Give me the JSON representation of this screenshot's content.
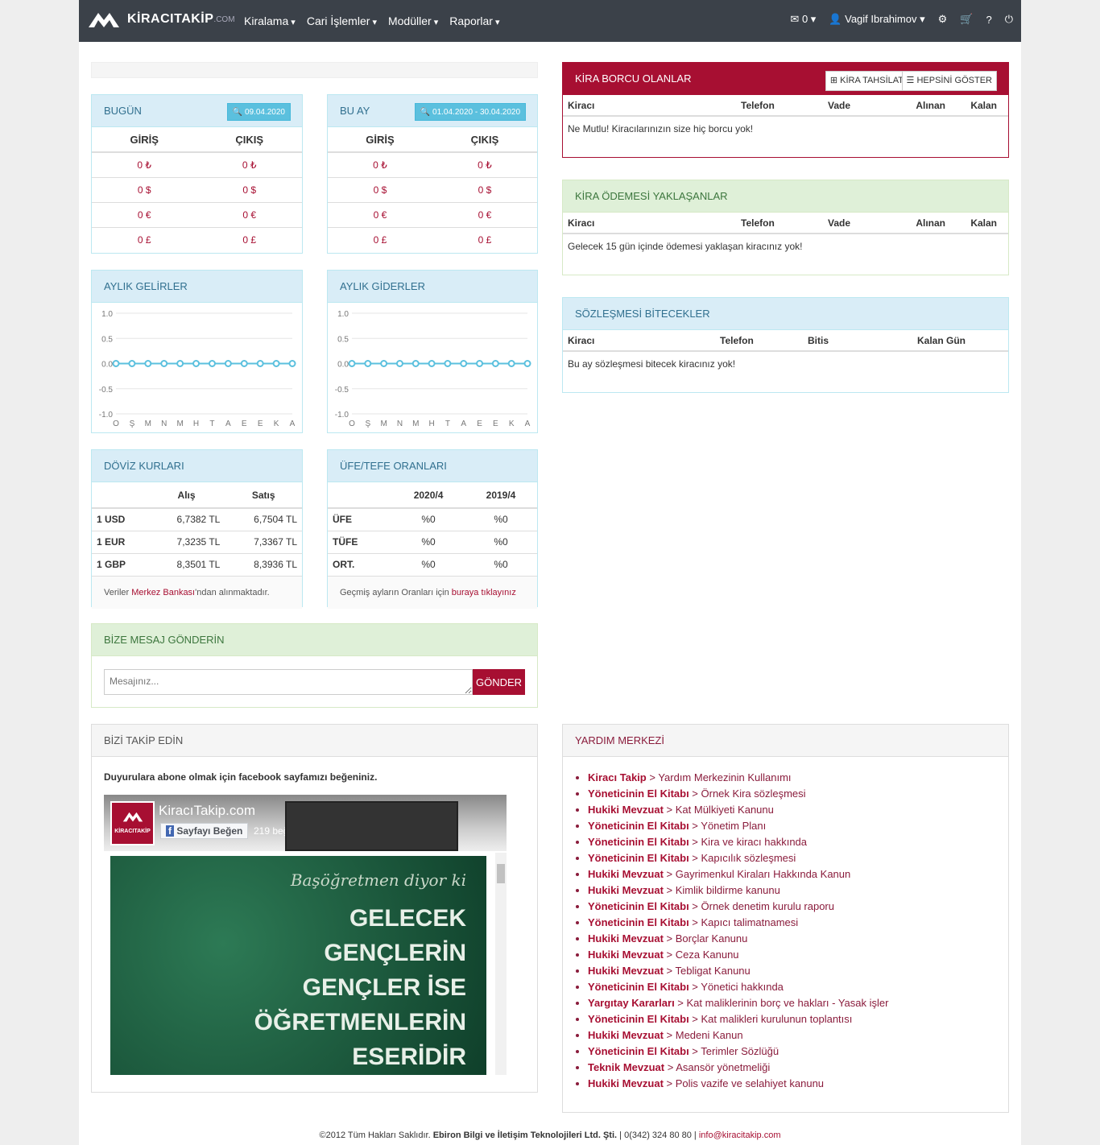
{
  "nav": {
    "brand": "KİRACITAKİP",
    "brand_suffix": ".COM",
    "menu": [
      "Kiralama",
      "Cari İşlemler",
      "Modüller",
      "Raporlar"
    ],
    "mail_count": "0",
    "user": "Vagif Ibrahimov"
  },
  "today": {
    "title": "BUGÜN",
    "date": "09.04.2020",
    "in": "GİRİŞ",
    "out": "ÇIKIŞ",
    "rows": [
      [
        "0 ₺",
        "0 ₺"
      ],
      [
        "0 $",
        "0 $"
      ],
      [
        "0 €",
        "0 €"
      ],
      [
        "0 £",
        "0 £"
      ]
    ]
  },
  "month": {
    "title": "BU AY",
    "date": "01.04.2020 - 30.04.2020",
    "in": "GİRİŞ",
    "out": "ÇIKIŞ",
    "rows": [
      [
        "0 ₺",
        "0 ₺"
      ],
      [
        "0 $",
        "0 $"
      ],
      [
        "0 €",
        "0 €"
      ],
      [
        "0 £",
        "0 £"
      ]
    ]
  },
  "chart_data": [
    {
      "type": "line",
      "title": "AYLIK GELİRLER",
      "categories": [
        "O",
        "Ş",
        "M",
        "N",
        "M",
        "H",
        "T",
        "A",
        "E",
        "E",
        "K",
        "A"
      ],
      "values": [
        0,
        0,
        0,
        0,
        0,
        0,
        0,
        0,
        0,
        0,
        0,
        0
      ],
      "ylim": [
        -1,
        1
      ],
      "yticks": [
        "1.0",
        "0.5",
        "0.0",
        "-0.5",
        "-1.0"
      ],
      "color": "#5bc0de"
    },
    {
      "type": "line",
      "title": "AYLIK GİDERLER",
      "categories": [
        "O",
        "Ş",
        "M",
        "N",
        "M",
        "H",
        "T",
        "A",
        "E",
        "E",
        "K",
        "A"
      ],
      "values": [
        0,
        0,
        0,
        0,
        0,
        0,
        0,
        0,
        0,
        0,
        0,
        0
      ],
      "ylim": [
        -1,
        1
      ],
      "yticks": [
        "1.0",
        "0.5",
        "0.0",
        "-0.5",
        "-1.0"
      ],
      "color": "#5bc0de"
    }
  ],
  "fx": {
    "title": "DÖVİZ KURLARI",
    "cols": [
      "Alış",
      "Satış"
    ],
    "rows": [
      [
        "1 USD",
        "6,7382 TL",
        "6,7504 TL"
      ],
      [
        "1 EUR",
        "7,3235 TL",
        "7,3367 TL"
      ],
      [
        "1 GBP",
        "8,3501 TL",
        "8,3936 TL"
      ]
    ],
    "note_a": "Veriler ",
    "note_link": "Merkez Bankası",
    "note_b": "'ndan alınmaktadır."
  },
  "ufe": {
    "title": "ÜFE/TEFE ORANLARI",
    "cols": [
      "2020/4",
      "2019/4"
    ],
    "rows": [
      [
        "ÜFE",
        "%0",
        "%0"
      ],
      [
        "TÜFE",
        "%0",
        "%0"
      ],
      [
        "ORT.",
        "%0",
        "%0"
      ]
    ],
    "note_a": "Geçmiş ayların Oranları için ",
    "note_link": "buraya tıklayınız"
  },
  "message": {
    "title": "BİZE MESAJ GÖNDERİN",
    "placeholder": "Mesajınız...",
    "send": "GÖNDER"
  },
  "debt": {
    "title": "KİRA BORCU OLANLAR",
    "btn1": "KİRA TAHSİLAT",
    "btn2": "HEPSİNİ GÖSTER",
    "cols": [
      "Kiracı",
      "Telefon",
      "Vade",
      "Alınan",
      "Kalan"
    ],
    "empty": "Ne Mutlu! Kiracılarınızın size hiç borcu yok!"
  },
  "upcoming": {
    "title": "KİRA ÖDEMESİ YAKLAŞANLAR",
    "cols": [
      "Kiracı",
      "Telefon",
      "Vade",
      "Alınan",
      "Kalan"
    ],
    "empty": "Gelecek 15 gün içinde ödemesi yaklaşan kiracınız yok!"
  },
  "contracts": {
    "title": "SÖZLEŞMESİ BİTECEKLER",
    "cols": [
      "Kiracı",
      "Telefon",
      "Bitis",
      "Kalan Gün"
    ],
    "empty": "Bu ay sözleşmesi bitecek kiracınız yok!"
  },
  "follow": {
    "title": "BİZİ TAKİP EDİN",
    "text": "Duyurulara abone olmak için facebook sayfamızı beğeniniz.",
    "fb_name": "KiracıTakip.com",
    "fb_like": "Sayfayı Beğen",
    "fb_count": "219 beğenme",
    "fb_logo": "KİRACITAKİP",
    "post_1": "Başöğretmen diyor ki",
    "post_2": "GELECEK",
    "post_3": "GENÇLERİN",
    "post_4": "GENÇLER İSE",
    "post_5": "ÖĞRETMENLERİN",
    "post_6": "ESERİDİR"
  },
  "help": {
    "title": "YARDIM MERKEZİ",
    "items": [
      [
        "Kiracı Takip",
        "Yardım Merkezinin Kullanımı"
      ],
      [
        "Yöneticinin El Kitabı",
        "Örnek Kira sözleşmesi"
      ],
      [
        "Hukiki Mevzuat",
        "Kat Mülkiyeti Kanunu"
      ],
      [
        "Yöneticinin El Kitabı",
        "Yönetim Planı"
      ],
      [
        "Yöneticinin El Kitabı",
        "Kira ve kiracı hakkında"
      ],
      [
        "Yöneticinin El Kitabı",
        "Kapıcılık sözleşmesi"
      ],
      [
        "Hukiki Mevzuat",
        "Gayrimenkul Kiraları Hakkında Kanun"
      ],
      [
        "Hukiki Mevzuat",
        "Kimlik bildirme kanunu"
      ],
      [
        "Yöneticinin El Kitabı",
        "Örnek denetim kurulu raporu"
      ],
      [
        "Yöneticinin El Kitabı",
        "Kapıcı talimatnamesi"
      ],
      [
        "Hukiki Mevzuat",
        "Borçlar Kanunu"
      ],
      [
        "Hukiki Mevzuat",
        "Ceza Kanunu"
      ],
      [
        "Hukiki Mevzuat",
        "Tebligat Kanunu"
      ],
      [
        "Yöneticinin El Kitabı",
        "Yönetici hakkında"
      ],
      [
        "Yargıtay Kararları",
        "Kat maliklerinin borç ve hakları - Yasak işler"
      ],
      [
        "Yöneticinin El Kitabı",
        "Kat malikleri kurulunun toplantısı"
      ],
      [
        "Hukiki Mevzuat",
        "Medeni Kanun"
      ],
      [
        "Yöneticinin El Kitabı",
        "Terimler Sözlüğü"
      ],
      [
        "Teknik Mevzuat",
        "Asansör yönetmeliği"
      ],
      [
        "Hukiki Mevzuat",
        "Polis vazife ve selahiyet kanunu"
      ]
    ]
  },
  "footer": {
    "copy": "©2012 Tüm Hakları Saklıdır.",
    "company": "Ebiron Bilgi ve İletişim Teknolojileri Ltd. Şti.",
    "phone": "| 0(342) 324 80 80 |",
    "email": "info@kiracitakip.com"
  }
}
